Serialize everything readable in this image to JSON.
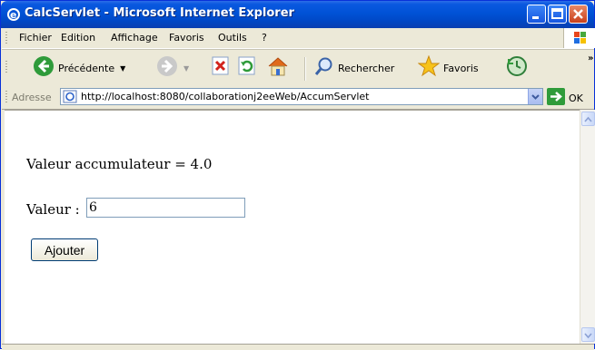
{
  "window": {
    "title": "CalcServlet - Microsoft Internet Explorer"
  },
  "menu": {
    "items": [
      {
        "label": "Fichier"
      },
      {
        "label": "Edition"
      },
      {
        "label": "Affichage"
      },
      {
        "label": "Favoris"
      },
      {
        "label": "Outils"
      },
      {
        "label": "?"
      }
    ]
  },
  "toolbar": {
    "back_label": "Précédente",
    "search_label": "Rechercher",
    "favorites_label": "Favoris",
    "overflow": "»"
  },
  "address": {
    "label": "Adresse",
    "url": "http://localhost:8080/collaborationj2eeWeb/AccumServlet",
    "go_label": "OK"
  },
  "page": {
    "accumulator_text": "Valeur accumulateur = 4.0",
    "value_label": "Valeur :",
    "value_input": "6",
    "submit_label": "Ajouter"
  },
  "colors": {
    "titlebar": "#0052d6",
    "chrome": "#ece9d8",
    "input_border": "#7f9db9"
  }
}
